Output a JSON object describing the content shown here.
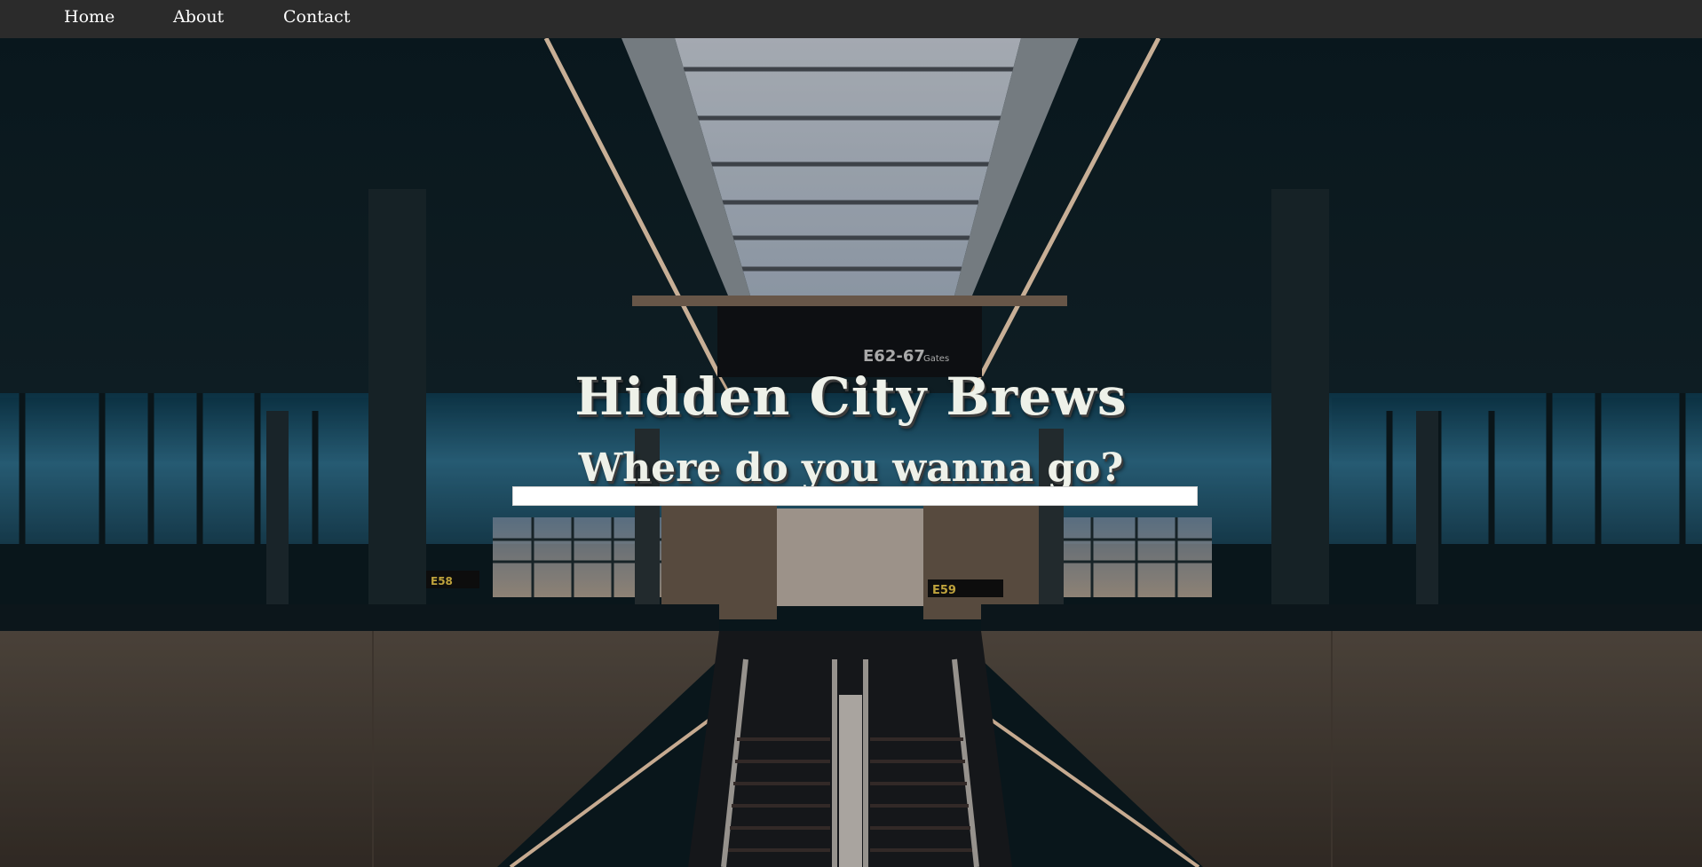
{
  "nav": {
    "items": [
      {
        "label": "Home"
      },
      {
        "label": "About"
      },
      {
        "label": "Contact"
      }
    ]
  },
  "hero": {
    "title": "Hidden City Brews",
    "subtitle": "Where do you wanna go?",
    "background_photo": {
      "signs": {
        "gates": "E62-67",
        "gates_word": "Gates",
        "left_gate": "E58",
        "right_gate": "E59"
      }
    }
  },
  "search": {
    "value": "",
    "placeholder": ""
  },
  "colors": {
    "navbar": "#2b2b2b",
    "nav_text": "#ffffff",
    "hero_text": "#eef1e9",
    "text_shadow": "#3b3b3b"
  }
}
